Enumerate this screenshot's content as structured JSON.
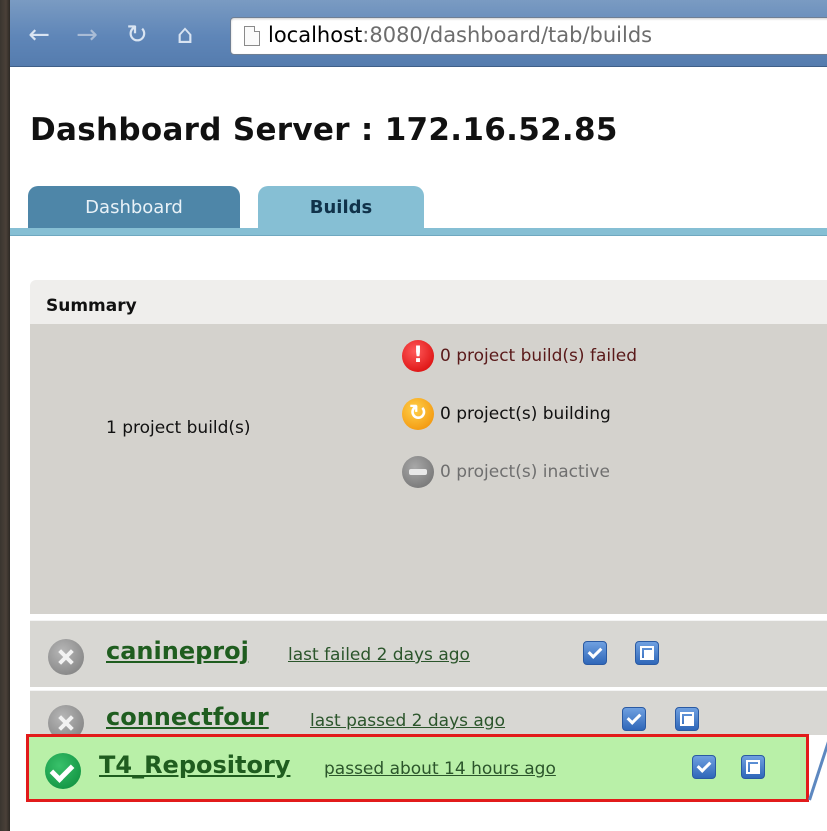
{
  "browser": {
    "url_host": "localhost",
    "url_rest": ":8080/dashboard/tab/builds"
  },
  "page": {
    "title": "Dashboard Server : 172.16.52.85"
  },
  "tabs": [
    {
      "label": "Dashboard",
      "active": false
    },
    {
      "label": "Builds",
      "active": true
    }
  ],
  "summary": {
    "header": "Summary",
    "total": "1 project build(s)",
    "failed": "0 project build(s) failed",
    "building": "0 project(s) building",
    "inactive": "0 project(s) inactive"
  },
  "projects": [
    {
      "name": "canineproj",
      "status": "last failed 2 days ago",
      "state": "failed"
    },
    {
      "name": "connectfour",
      "status": "last passed 2 days ago",
      "state": "failed"
    },
    {
      "name": "T4_Repository",
      "status": "passed about 14 hours ago",
      "state": "passed"
    }
  ],
  "colors": {
    "toolbar": "#5f86b8",
    "tab_active": "#86bfd4",
    "tab_inactive": "#4e86a8",
    "passed_row": "#b9f0a8",
    "highlight_border": "#e21b1b"
  }
}
